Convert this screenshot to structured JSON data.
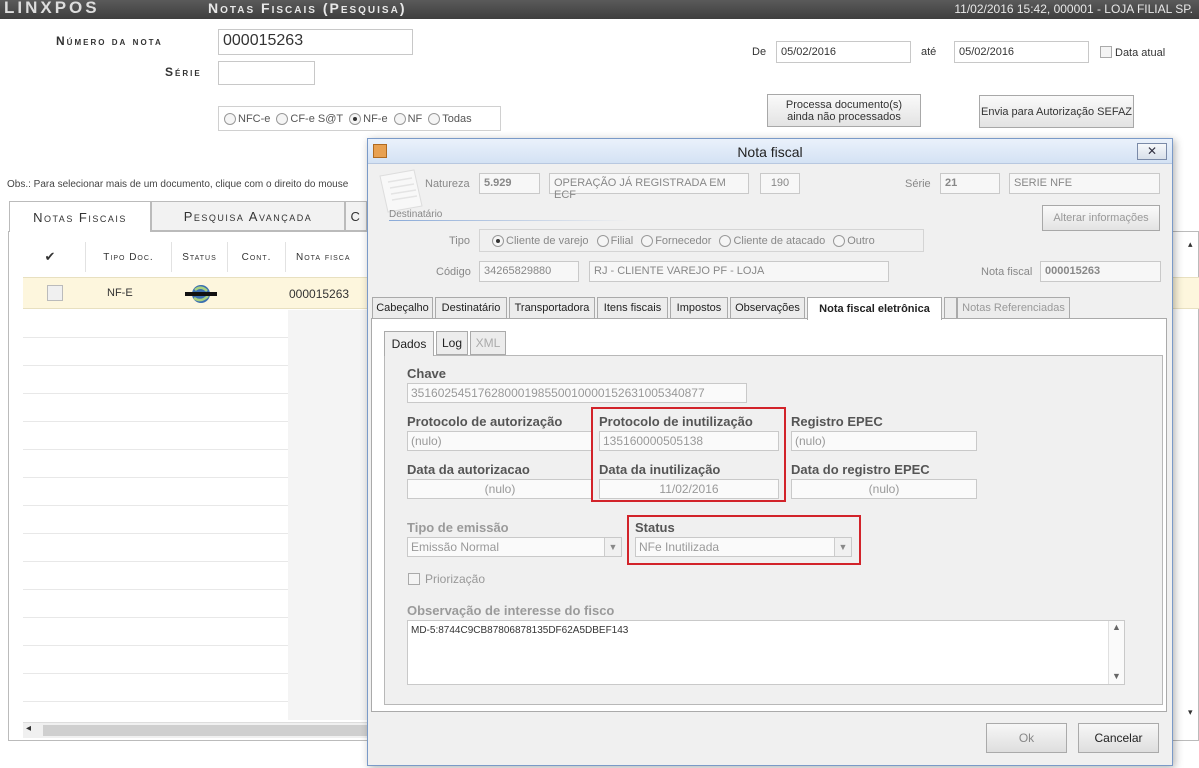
{
  "app": {
    "brand": "LINXPOS",
    "title": "Notas Fiscais (Pesquisa)",
    "status": "11/02/2016 15:42, 000001 - LOJA FILIAL SP."
  },
  "search": {
    "numero_label": "Número da nota",
    "numero_value": "000015263",
    "serie_label": "Série",
    "serie_value": "",
    "de_label": "De",
    "de_value": "05/02/2016",
    "ate_label": "até",
    "ate_value": "05/02/2016",
    "data_atual_label": "Data atual",
    "doc_types": [
      "NFC-e",
      "CF-e S@T",
      "NF-e",
      "NF",
      "Todas"
    ],
    "doc_type_selected": "NF-e",
    "btn_processa": "Processa documento(s) ainda não processados",
    "btn_envia": "Envia para Autorização SEFAZ",
    "obs": "Obs.: Para selecionar mais de um documento, clique com o direito do mouse"
  },
  "main_tabs": [
    "Notas Fiscais",
    "Pesquisa Avançada",
    "C"
  ],
  "grid": {
    "headers": [
      "✔",
      "Tipo Doc.",
      "Status",
      "Cont.",
      "Nota fisca"
    ],
    "rows": [
      {
        "tipo": "NF-E",
        "nota": "000015263"
      }
    ]
  },
  "modal": {
    "title": "Nota fiscal",
    "close": "✕",
    "natureza_label": "Natureza",
    "natureza_code": "5.929",
    "natureza_desc": "OPERAÇÃO JÁ REGISTRADA EM ECF",
    "natureza_extra": "190",
    "serie_label": "Série",
    "serie_code": "21",
    "serie_desc": "SERIE NFE",
    "destinatario_label": "Destinatário",
    "alterar_btn": "Alterar informações",
    "tipo_label": "Tipo",
    "tipos": [
      "Cliente de varejo",
      "Filial",
      "Fornecedor",
      "Cliente de atacado",
      "Outro"
    ],
    "tipo_selected": "Cliente de varejo",
    "codigo_label": "Código",
    "codigo_value": "34265829880",
    "codigo_desc": "RJ - CLIENTE VAREJO PF - LOJA",
    "nota_fiscal_label": "Nota fiscal",
    "nota_fiscal_value": "000015263",
    "tabs": [
      "Cabeçalho",
      "Destinatário",
      "Transportadora",
      "Itens fiscais",
      "Impostos",
      "Observações",
      "Nota fiscal eletrônica",
      "Notas Referenciadas"
    ],
    "active_tab": "Nota fiscal eletrônica",
    "subtabs": [
      "Dados",
      "Log",
      "XML"
    ],
    "dados": {
      "chave_label": "Chave",
      "chave_value": "35160254517628000198550010000152631005340877",
      "prot_aut_label": "Protocolo de autorização",
      "prot_aut_value": "(nulo)",
      "prot_inut_label": "Protocolo de inutilização",
      "prot_inut_value": "135160000505138",
      "reg_epec_label": "Registro EPEC",
      "reg_epec_value": "(nulo)",
      "data_aut_label": "Data da autorizacao",
      "data_aut_value": "(nulo)",
      "data_inut_label": "Data da inutilização",
      "data_inut_value": "11/02/2016",
      "data_epec_label": "Data do registro EPEC",
      "data_epec_value": "(nulo)",
      "tipo_emissao_label": "Tipo de emissão",
      "tipo_emissao_value": "Emissão Normal",
      "status_label": "Status",
      "status_value": "NFe Inutilizada",
      "priorizacao_label": "Priorização",
      "obs_fisco_label": "Observação de interesse do fisco",
      "obs_fisco_value": "MD-5:8744C9CB87806878135DF62A5DBEF143"
    },
    "ok_btn": "Ok",
    "cancel_btn": "Cancelar"
  },
  "colors": {
    "highlight": "#d2232a",
    "titlebar": "#4a4a4a",
    "row_selected": "#fdf6dd"
  }
}
